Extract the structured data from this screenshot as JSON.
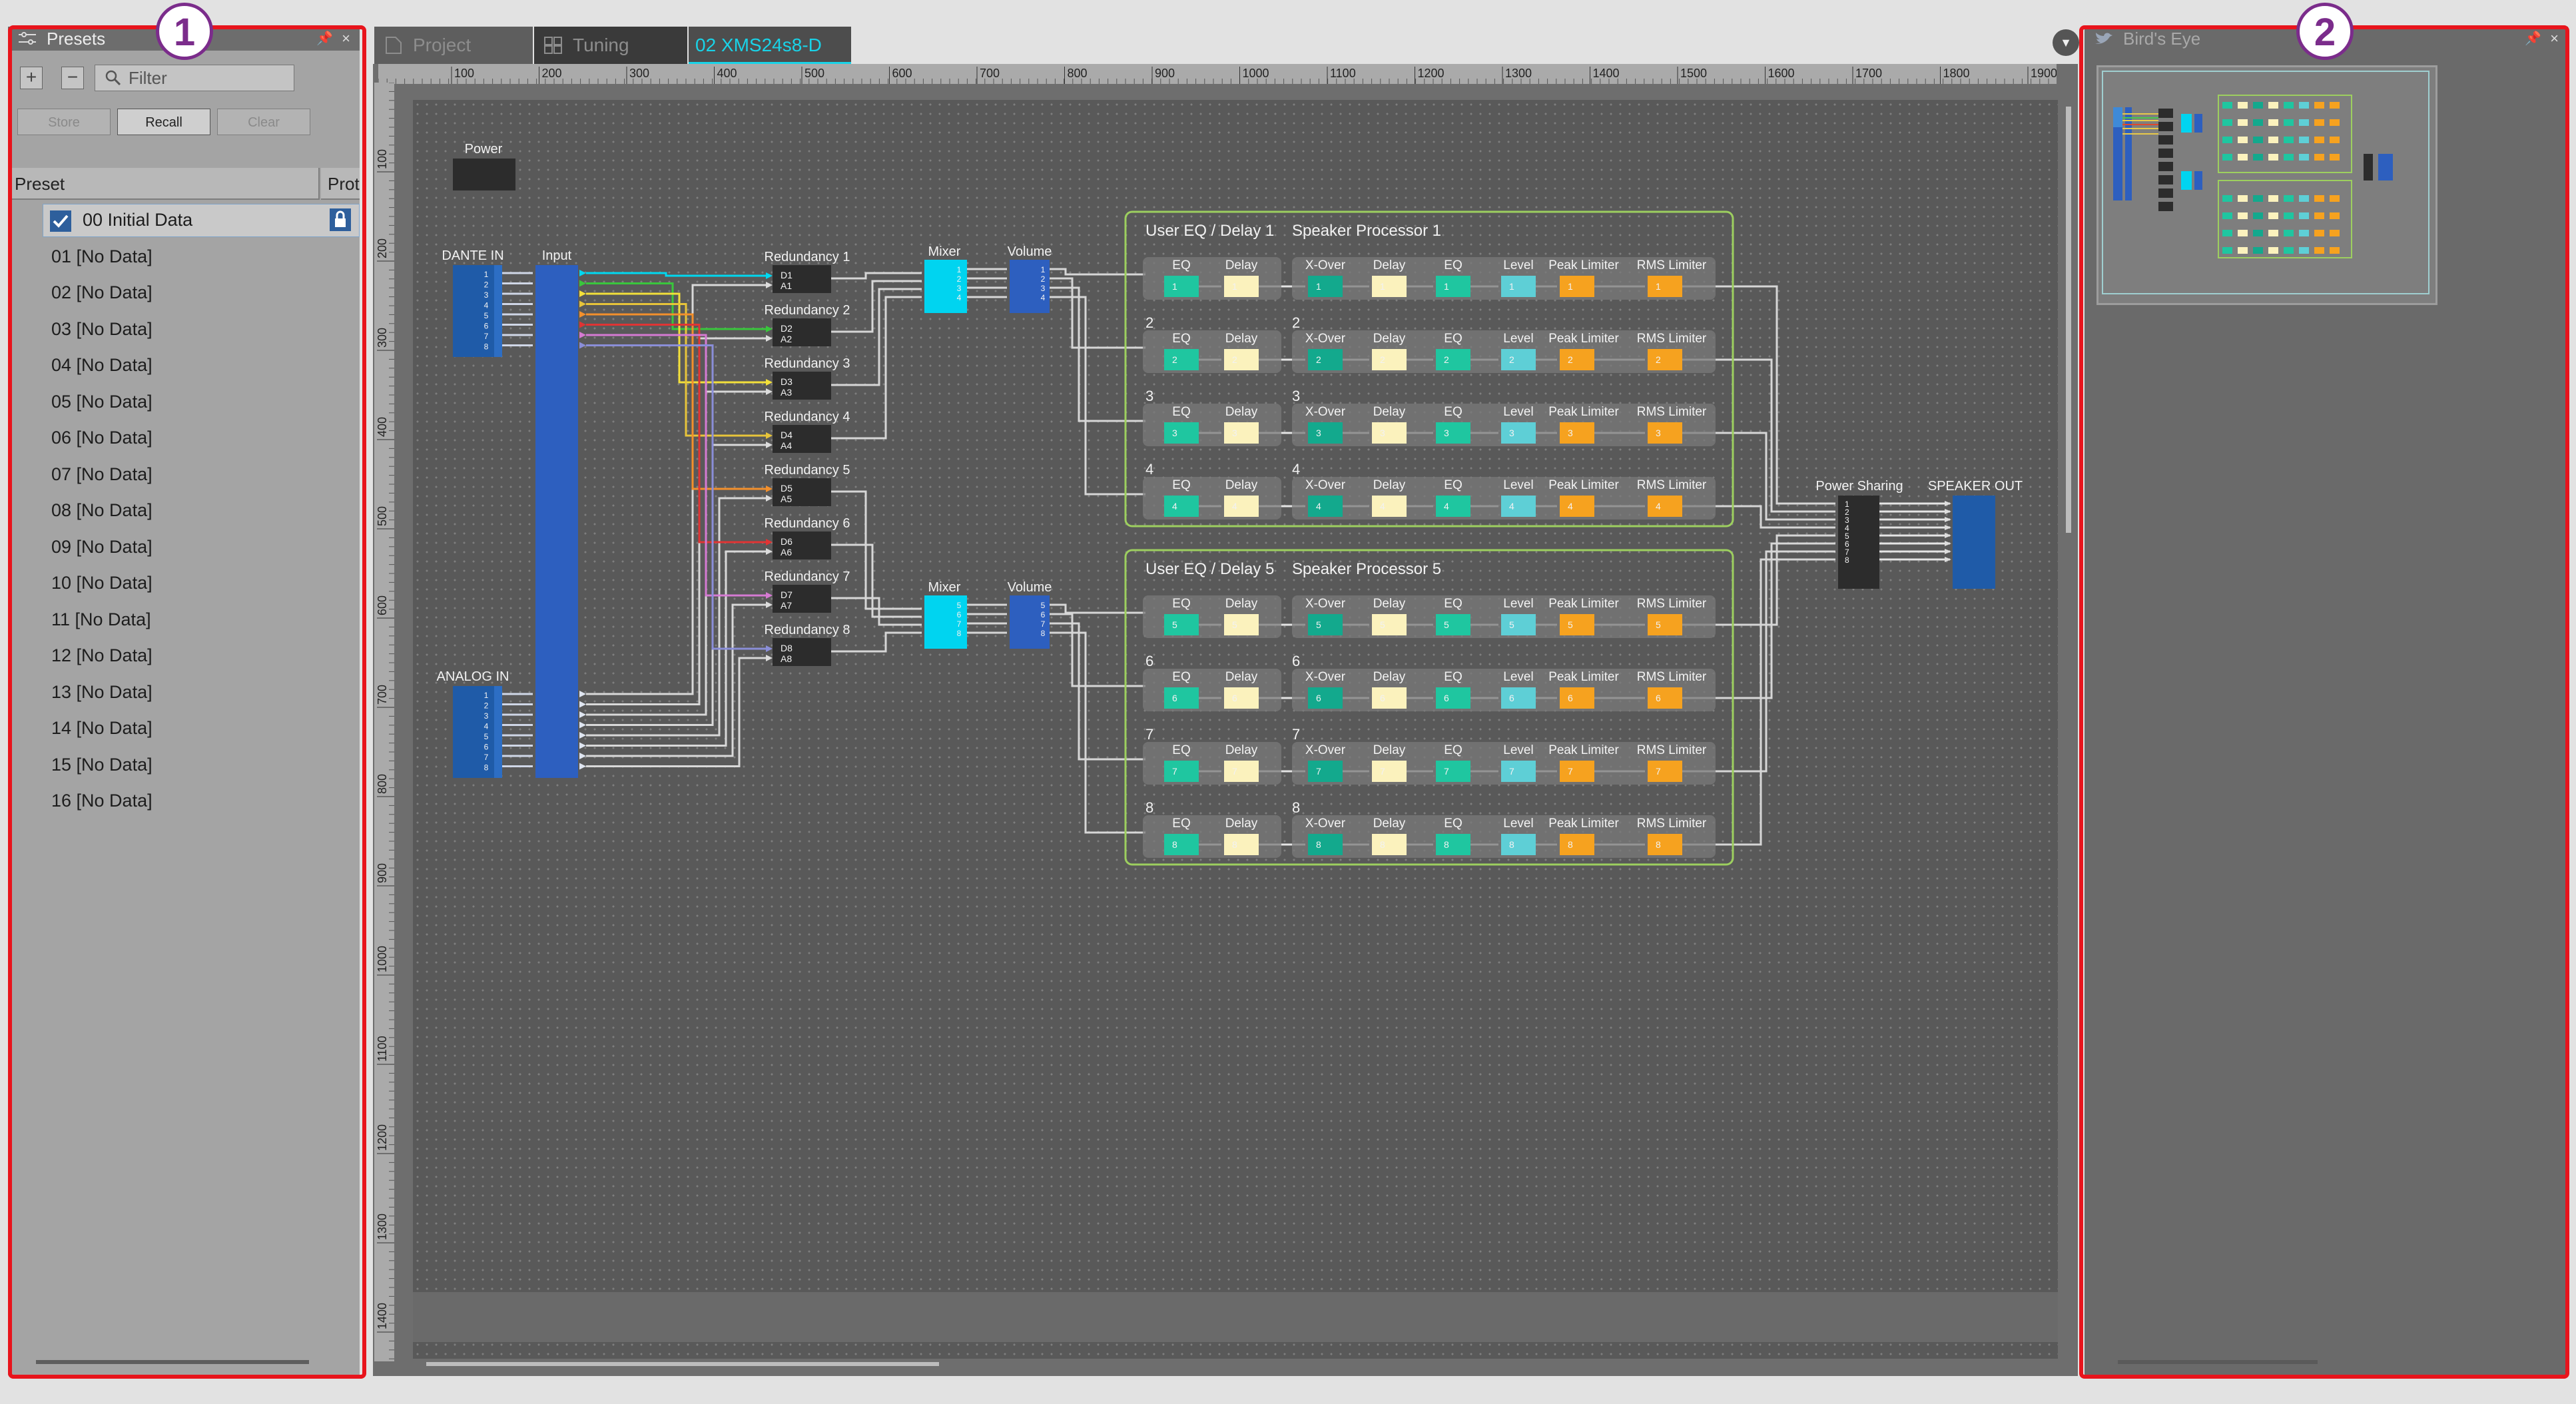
{
  "presets_panel": {
    "title": "Presets",
    "filter_placeholder": "Filter",
    "store_label": "Store",
    "recall_label": "Recall",
    "clear_label": "Clear",
    "col_preset": "Preset",
    "col_protect": "Prot",
    "items": [
      "00 Initial Data",
      "01 [No Data]",
      "02 [No Data]",
      "03 [No Data]",
      "04 [No Data]",
      "05 [No Data]",
      "06 [No Data]",
      "07 [No Data]",
      "08 [No Data]",
      "09 [No Data]",
      "10 [No Data]",
      "11 [No Data]",
      "12 [No Data]",
      "13 [No Data]",
      "14 [No Data]",
      "15 [No Data]",
      "16 [No Data]"
    ]
  },
  "tabs": [
    {
      "label": "Project"
    },
    {
      "label": "Tuning"
    },
    {
      "label": "02 XMS24s8-D"
    }
  ],
  "ruler": {
    "x": [
      "100",
      "200",
      "300",
      "400",
      "500",
      "600",
      "700",
      "800",
      "900",
      "1000",
      "1100",
      "1200",
      "1300",
      "1400",
      "1500",
      "1600",
      "1700",
      "1800",
      "1900"
    ],
    "y": [
      "100",
      "200",
      "300",
      "400",
      "500",
      "600",
      "700",
      "800",
      "900",
      "1000",
      "1100",
      "1200",
      "1300",
      "1400"
    ]
  },
  "diagram": {
    "power": "Power",
    "dante_in": "DANTE IN",
    "input": "Input",
    "analog_in": "ANALOG IN",
    "mixer": "Mixer",
    "volume": "Volume",
    "power_sharing": "Power Sharing",
    "speaker_out": "SPEAKER OUT",
    "user_eq_group1": "User EQ / Delay 1",
    "user_eq_group2": "User EQ / Delay 5",
    "sp_group1": "Speaker Processor 1",
    "sp_group2": "Speaker Processor 5",
    "lbl_eq": "EQ",
    "lbl_delay": "Delay",
    "lbl_xover": "X-Over",
    "lbl_level": "Level",
    "lbl_peak": "Peak Limiter",
    "lbl_rms": "RMS Limiter",
    "redundancy": [
      "Redundancy 1",
      "Redundancy 2",
      "Redundancy 3",
      "Redundancy 4",
      "Redundancy 5",
      "Redundancy 6",
      "Redundancy 7",
      "Redundancy 8"
    ],
    "red_ports": [
      [
        "D1",
        "A1"
      ],
      [
        "D2",
        "A2"
      ],
      [
        "D3",
        "A3"
      ],
      [
        "D4",
        "A4"
      ],
      [
        "D5",
        "A5"
      ],
      [
        "D6",
        "A6"
      ],
      [
        "D7",
        "A7"
      ],
      [
        "D8",
        "A8"
      ]
    ],
    "channel_nums": [
      "1",
      "2",
      "3",
      "4",
      "5",
      "6",
      "7",
      "8"
    ],
    "row_labels": [
      "2",
      "3",
      "4",
      "6",
      "7",
      "8"
    ]
  },
  "birds_eye": {
    "title": "Bird's Eye"
  },
  "callouts": [
    "1",
    "2"
  ],
  "colors": {
    "accent": "#00c8e0",
    "eq_teal": "#1fc6a0",
    "delay_yellow": "#fbf2bd",
    "peak_orange": "#f6a21f",
    "dsp_blue": "#2d5fbf",
    "cyan_block": "#00d4f0",
    "frame_green": "#9dcf5f"
  }
}
